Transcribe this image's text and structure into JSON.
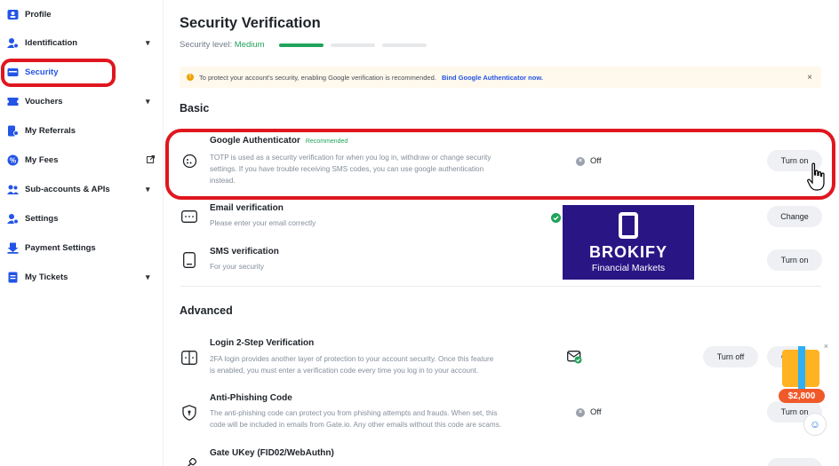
{
  "sidebar": {
    "items": [
      {
        "label": "Profile",
        "icon": "profile-icon"
      },
      {
        "label": "Identification",
        "icon": "identification-icon",
        "chevron": true
      },
      {
        "label": "Security",
        "icon": "security-icon",
        "active": true
      },
      {
        "label": "Vouchers",
        "icon": "voucher-icon",
        "chevron": true
      },
      {
        "label": "My Referrals",
        "icon": "referral-icon"
      },
      {
        "label": "My Fees",
        "icon": "fees-icon",
        "external": true
      },
      {
        "label": "Sub-accounts & APIs",
        "icon": "sub-accounts-icon",
        "chevron": true
      },
      {
        "label": "Settings",
        "icon": "settings-icon"
      },
      {
        "label": "Payment Settings",
        "icon": "payment-icon"
      },
      {
        "label": "My Tickets",
        "icon": "tickets-icon",
        "chevron": true
      }
    ]
  },
  "main": {
    "title": "Security Verification",
    "security_level_label": "Security level:",
    "security_level_value": "Medium",
    "security_level_steps_filled": 1,
    "security_level_steps_total": 3,
    "notice": {
      "text": "To protect your account's security, enabling Google verification is recommended.",
      "link": "Bind Google Authenticator now.",
      "close": "×"
    },
    "basic_heading": "Basic",
    "advanced_heading": "Advanced",
    "basic": [
      {
        "title": "Google Authenticator",
        "badge": "Recommended",
        "desc1": "TOTP is used as a security verification for when you log in, withdraw or change security",
        "desc2": "settings. If you have trouble receiving SMS codes, you can use google authentication",
        "desc3": "instead.",
        "status": "Off",
        "button": "Turn on"
      },
      {
        "title": "Email verification",
        "desc1": "Please enter your email correctly",
        "button": "Change"
      },
      {
        "title": "SMS verification",
        "desc1": "For your security",
        "button": "Turn on"
      }
    ],
    "advanced": [
      {
        "title": "Login 2-Step Verification",
        "desc1": "2FA login provides another layer of protection to your account security. Once this feature",
        "desc2": "is enabled, you must enter a verification code every time you log in to your account.",
        "button1": "Turn off",
        "button2": "Cha"
      },
      {
        "title": "Anti-Phishing Code",
        "desc1": "The anti-phishing code can protect you from phishing attempts and frauds. When set, this",
        "desc2": "code will be included in emails from Gate.io. Any other emails without this code are scams.",
        "status": "Off",
        "button": "Turn on"
      },
      {
        "title": "Gate UKey (FID02/WebAuthn)"
      }
    ]
  },
  "ad": {
    "brand": "BROKIFY",
    "subtitle": "Financial Markets"
  },
  "promo": {
    "amount": "$2,800",
    "close": "×"
  },
  "colors": {
    "accent": "#2354e6",
    "highlight": "#e0161e",
    "success": "#20a35a",
    "ad_bg": "#2a1585"
  }
}
